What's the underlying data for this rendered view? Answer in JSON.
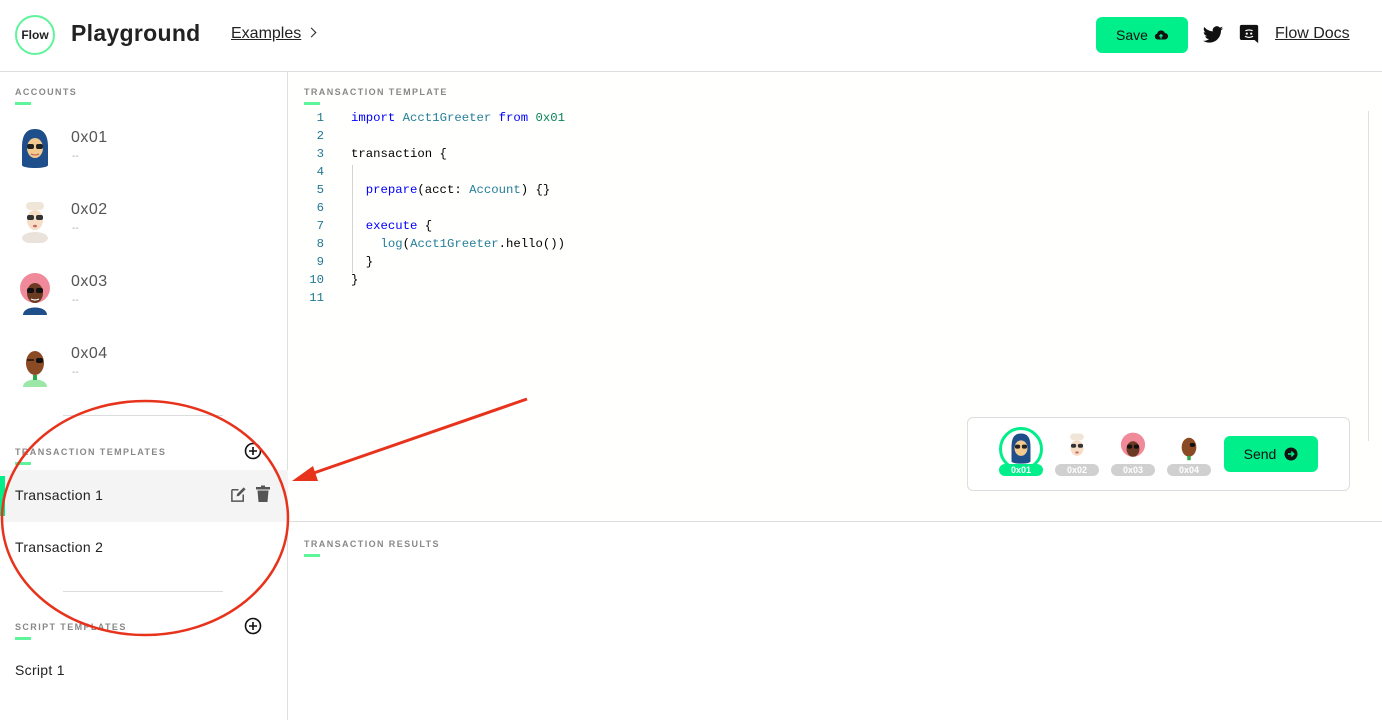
{
  "header": {
    "logo_text": "Flow",
    "title": "Playground",
    "examples_label": "Examples",
    "save_label": "Save",
    "docs_label": "Flow Docs"
  },
  "sidebar": {
    "accounts_label": "ACCOUNTS",
    "accounts": [
      {
        "address": "0x01",
        "sub": "--",
        "avatar": "avatar-blue-hijab"
      },
      {
        "address": "0x02",
        "sub": "--",
        "avatar": "avatar-white-hair"
      },
      {
        "address": "0x03",
        "sub": "--",
        "avatar": "avatar-pink-hair"
      },
      {
        "address": "0x04",
        "sub": "--",
        "avatar": "avatar-bald-glasses"
      }
    ],
    "transaction_templates_label": "TRANSACTION TEMPLATES",
    "transactions": [
      {
        "label": "Transaction 1",
        "active": true
      },
      {
        "label": "Transaction 2",
        "active": false
      }
    ],
    "script_templates_label": "SCRIPT TEMPLATES",
    "scripts": [
      {
        "label": "Script 1"
      }
    ]
  },
  "editor": {
    "section_label": "TRANSACTION TEMPLATE",
    "line_numbers": [
      "1",
      "2",
      "3",
      "4",
      "5",
      "6",
      "7",
      "8",
      "9",
      "10",
      "11"
    ],
    "lines": [
      "import Acct1Greeter from 0x01",
      "",
      "transaction {",
      "",
      "  prepare(acct: Account) {}",
      "",
      "  execute {",
      "    log(Acct1Greeter.hello())",
      "  }",
      "}",
      ""
    ]
  },
  "signers": {
    "items": [
      {
        "label": "0x01",
        "selected": true
      },
      {
        "label": "0x02",
        "selected": false
      },
      {
        "label": "0x03",
        "selected": false
      },
      {
        "label": "0x04",
        "selected": false
      }
    ],
    "send_label": "Send"
  },
  "results": {
    "section_label": "TRANSACTION RESULTS"
  },
  "colors": {
    "accent": "#00ef8b",
    "annotation": "#e8331c"
  }
}
